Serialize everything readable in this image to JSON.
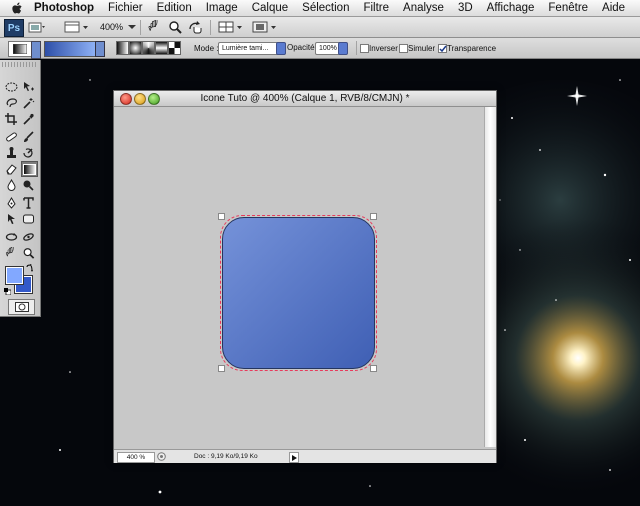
{
  "menubar": {
    "app_name": "Photoshop",
    "items": [
      "Fichier",
      "Edition",
      "Image",
      "Calque",
      "Sélection",
      "Filtre",
      "Analyse",
      "3D",
      "Affichage",
      "Fenêtre",
      "Aide"
    ]
  },
  "appbar": {
    "logo_text": "Ps",
    "zoom": "400%"
  },
  "options": {
    "mode_label": "Mode :",
    "mode_value": "Lumière tami...",
    "opacity_label": "Opacité :",
    "opacity_value": "100%",
    "reverse_label": "Inverser",
    "simulate_label": "Simuler",
    "transparency_label": "Transparence",
    "gradient_start_color": "#2e4fa8",
    "gradient_end_color": "#8eb1f5"
  },
  "tools": {
    "foreground_color": "#82a8ff",
    "background_color": "#3359c9",
    "active": "gradient-tool"
  },
  "document": {
    "title": "Icone Tuto @ 400% (Calque 1, RVB/8/CMJN) *",
    "zoom_value": "400 %",
    "doc_info": "Doc : 9,19 Ko/9,19 Ko",
    "icon_gradient_start": "#7592d9",
    "icon_gradient_end": "#3f5fb4"
  }
}
